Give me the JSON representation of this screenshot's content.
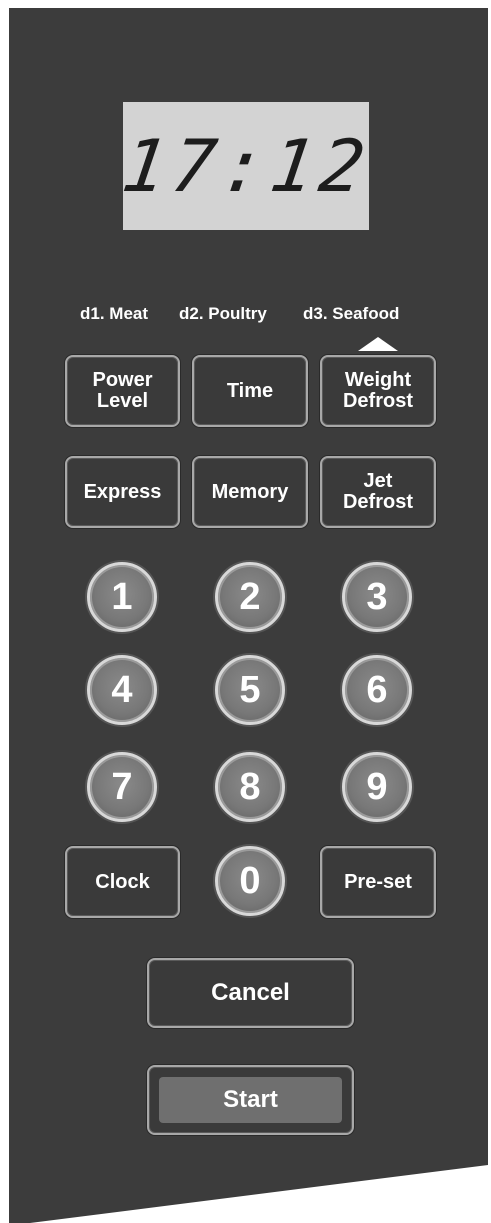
{
  "display": {
    "time": "17:12"
  },
  "defrost_labels": {
    "d1": "d1. Meat",
    "d2": "d2. Poultry",
    "d3": "d3. Seafood"
  },
  "buttons": {
    "power_level": [
      "Power",
      "Level"
    ],
    "time": "Time",
    "weight_defrost": [
      "Weight",
      "Defrost"
    ],
    "express": "Express",
    "memory": "Memory",
    "jet_defrost": [
      "Jet",
      "Defrost"
    ],
    "clock": "Clock",
    "preset": "Pre-set",
    "cancel": "Cancel",
    "start": "Start"
  },
  "keypad": [
    "1",
    "2",
    "3",
    "4",
    "5",
    "6",
    "7",
    "8",
    "9",
    "0"
  ],
  "colors": {
    "panel": "#3c3c3c",
    "lcd": "#d3d3d3",
    "key": "#787878",
    "start_inner": "#6f6f6f"
  }
}
